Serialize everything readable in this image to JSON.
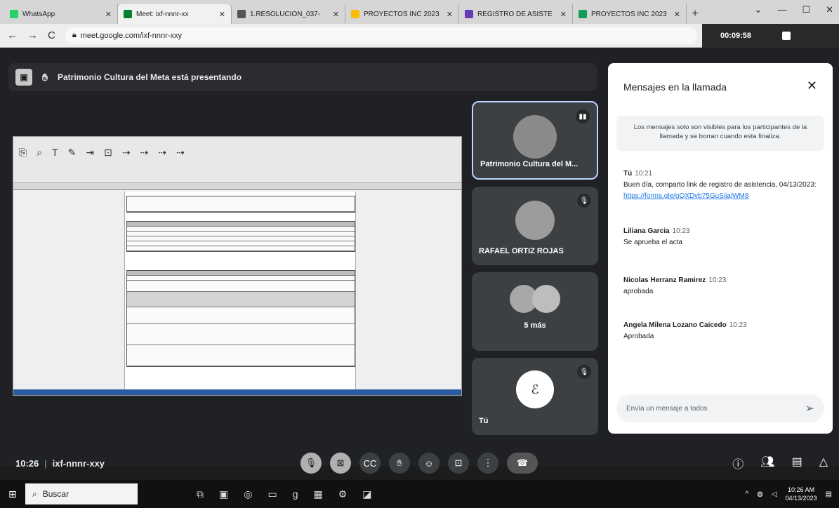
{
  "browser": {
    "tabs": [
      {
        "label": "WhatsApp",
        "icon": "whatsapp-icon",
        "color": "#25d366",
        "active": false
      },
      {
        "label": "Meet: ixf-nnnr-xx",
        "icon": "meet-icon",
        "color": "#00832d",
        "active": true
      },
      {
        "label": "1.RESOLUCIÓN_037-",
        "icon": "web-icon",
        "color": "#555555",
        "active": false
      },
      {
        "label": "PROYECTOS INC 2023",
        "icon": "drive-icon",
        "color": "#fbbc04",
        "active": false
      },
      {
        "label": "REGISTRO DE ASISTE",
        "icon": "forms-icon",
        "color": "#673ab7",
        "active": false
      },
      {
        "label": "PROYECTOS INC 2023",
        "icon": "sheets-icon",
        "color": "#0f9d58",
        "active": false
      }
    ],
    "url": "meet.google.com/ixf-nnnr-xxy",
    "recording_time": "00:09:58"
  },
  "meet": {
    "presenting_text": "Patrimonio Cultura del Meta está presentando",
    "participants": [
      {
        "name": "Patrimonio Cultura del M...",
        "speaking": true
      },
      {
        "name": "RAFAEL ORTIZ ROJAS",
        "speaking": false
      },
      {
        "name": "5 más",
        "speaking": false
      },
      {
        "name": "Tú",
        "speaking": false
      }
    ],
    "chat": {
      "title": "Mensajes en la llamada",
      "notice": "Los mensajes solo son visibles para los participantes de la llamada y se borran cuando esta finaliza.",
      "messages": [
        {
          "sender": "Tú",
          "time": "10:21",
          "text": "Buen día, comparto link de registro de asistencia, 04/13/2023: ",
          "link": "https://forms.gle/gQXDvb75GuSiiajWM8"
        },
        {
          "sender": "Liliana Garcia",
          "time": "10:23",
          "text": "Se aprueba el acta",
          "link": ""
        },
        {
          "sender": "Nicolas Herranz Ramirez",
          "time": "10:23",
          "text": "aprobada",
          "link": ""
        },
        {
          "sender": "Angela Milena Lozano Caicedo",
          "time": "10:23",
          "text": "Aprobada",
          "link": ""
        }
      ],
      "input_placeholder": "Envía un mensaje a todos"
    },
    "meeting_time": "10:26",
    "meeting_code": "ixf-nnnr-xxy"
  },
  "taskbar": {
    "search_label": "Buscar",
    "time": "10:26 AM",
    "date": "04/13/2023"
  }
}
